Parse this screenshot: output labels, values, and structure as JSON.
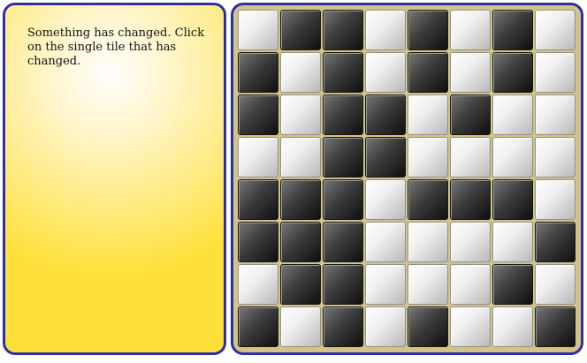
{
  "instructions": {
    "text": "Something has changed. Click on the single tile that has changed."
  },
  "board": {
    "rows": [
      [
        "light",
        "dark",
        "dark",
        "light",
        "dark",
        "light",
        "dark",
        "light"
      ],
      [
        "dark",
        "light",
        "dark",
        "light",
        "dark",
        "light",
        "dark",
        "light"
      ],
      [
        "dark",
        "light",
        "dark",
        "dark",
        "light",
        "dark",
        "light",
        "light"
      ],
      [
        "light",
        "light",
        "dark",
        "dark",
        "light",
        "light",
        "light",
        "light"
      ],
      [
        "dark",
        "dark",
        "dark",
        "light",
        "dark",
        "dark",
        "dark",
        "light"
      ],
      [
        "dark",
        "dark",
        "dark",
        "light",
        "light",
        "light",
        "light",
        "dark"
      ],
      [
        "light",
        "dark",
        "dark",
        "light",
        "light",
        "light",
        "dark",
        "light"
      ],
      [
        "dark",
        "light",
        "dark",
        "light",
        "dark",
        "light",
        "light",
        "dark"
      ]
    ]
  },
  "colors": {
    "panel_border": "#2e2ea8",
    "panel_fill_center": "#ffffff",
    "panel_fill_edge": "#ffe03a",
    "tile_dark": "#222222",
    "tile_light": "#f2f2f2"
  }
}
